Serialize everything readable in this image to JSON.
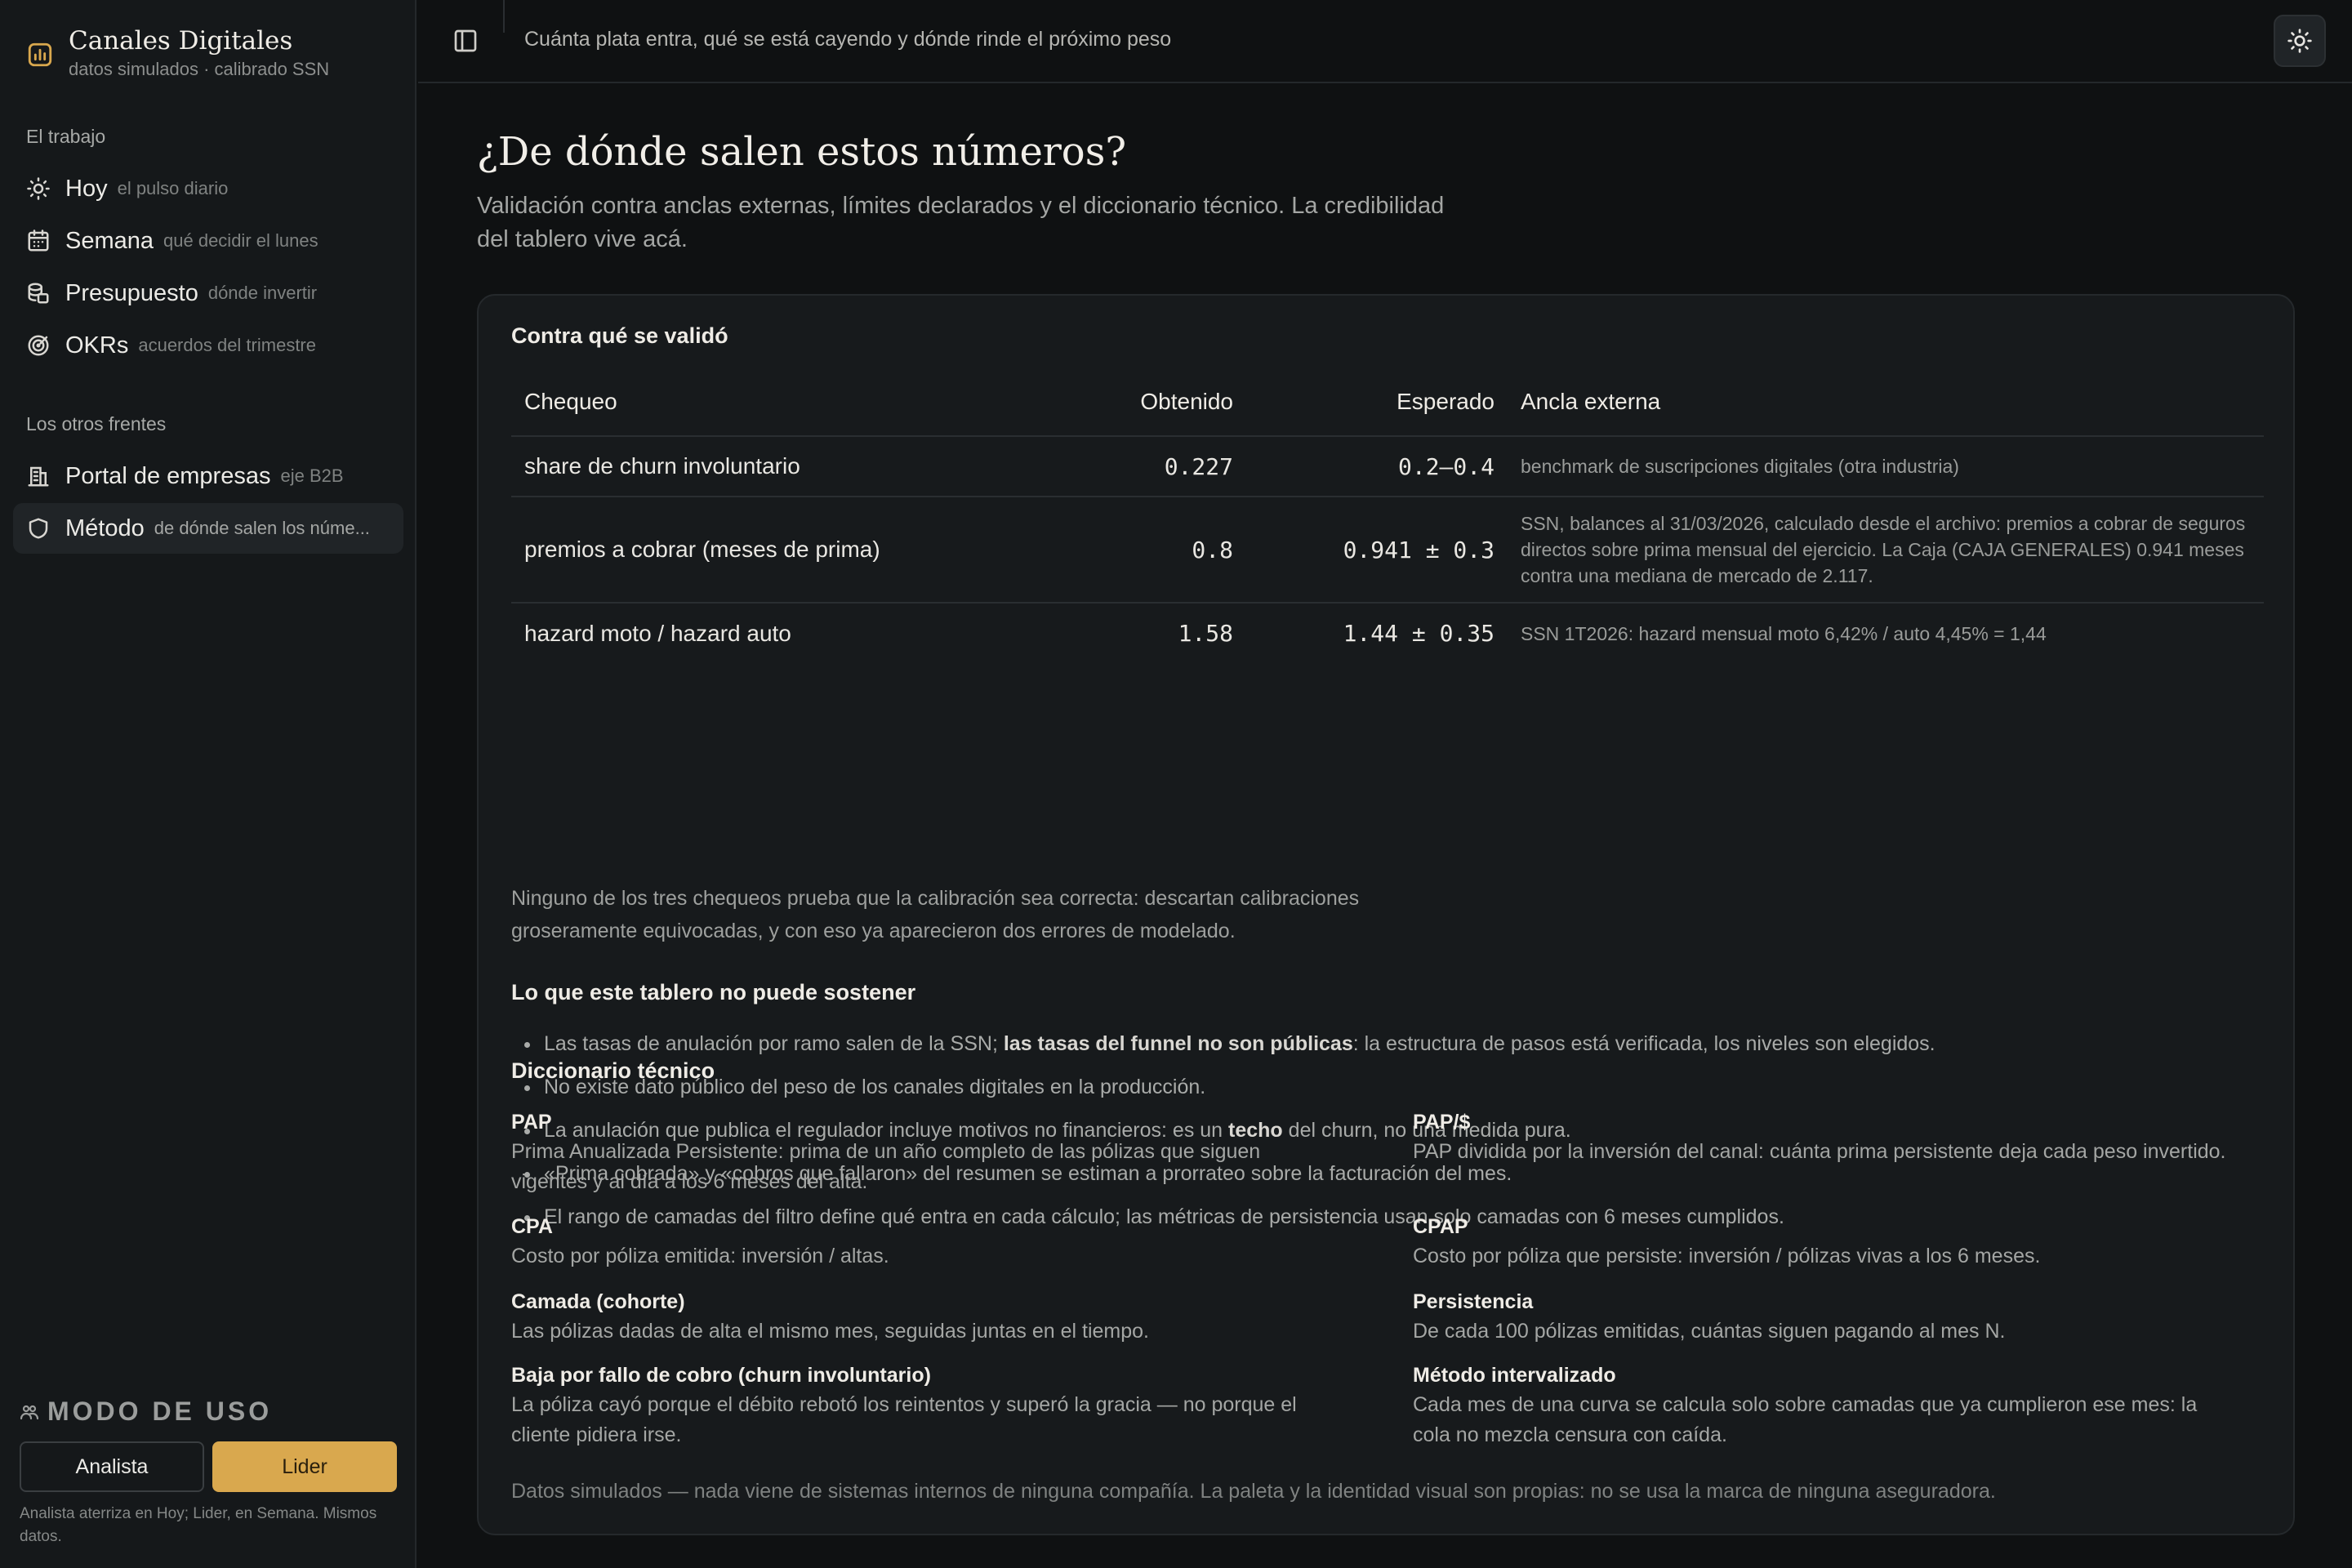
{
  "app": {
    "title": "Canales Digitales",
    "subtitle": "datos simulados · calibrado SSN"
  },
  "sidebar": {
    "section_work": "El trabajo",
    "section_other": "Los otros frentes",
    "items": [
      {
        "label": "Hoy",
        "hint": "el pulso diario",
        "icon": "sun-icon"
      },
      {
        "label": "Semana",
        "hint": "qué decidir el lunes",
        "icon": "calendar-icon"
      },
      {
        "label": "Presupuesto",
        "hint": "dónde invertir",
        "icon": "coins-icon"
      },
      {
        "label": "OKRs",
        "hint": "acuerdos del trimestre",
        "icon": "target-icon"
      },
      {
        "label": "Portal de empresas",
        "hint": "eje B2B",
        "icon": "building-icon"
      },
      {
        "label": "Método",
        "hint": "de dónde salen los núme...",
        "icon": "shield-icon",
        "active": true
      }
    ]
  },
  "mode": {
    "title": "MODO DE USO",
    "analista": "Analista",
    "lider": "Lider",
    "selected": "Lider",
    "note": "Analista aterriza en Hoy; Lider, en Semana. Mismos datos."
  },
  "topbar": {
    "text": "Cuánta plata entra, qué se está cayendo y dónde rinde el próximo peso"
  },
  "page": {
    "title": "¿De dónde salen estos números?",
    "subtitle": "Validación contra anclas externas, límites declarados y el diccionario técnico. La credibilidad del tablero vive acá."
  },
  "validation": {
    "heading": "Contra qué se validó",
    "columns": {
      "check": "Chequeo",
      "obtained": "Obtenido",
      "expected": "Esperado",
      "anchor": "Ancla externa"
    },
    "rows": [
      {
        "check": "share de churn involuntario",
        "obtained": "0.227",
        "expected": "0.2–0.4",
        "anchor": "benchmark de suscripciones digitales (otra industria)"
      },
      {
        "check": "premios a cobrar (meses de prima)",
        "obtained": "0.8",
        "expected": "0.941 ± 0.3",
        "anchor": "SSN, balances al 31/03/2026, calculado desde el archivo: premios a cobrar de seguros directos sobre prima mensual del ejercicio. La Caja (CAJA GENERALES) 0.941 meses contra una mediana de mercado de 2.117."
      },
      {
        "check": "hazard moto / hazard auto",
        "obtained": "1.58",
        "expected": "1.44 ± 0.35",
        "anchor": "SSN 1T2026: hazard mensual moto 6,42% / auto 4,45% = 1,44"
      }
    ],
    "note": "Ninguno de los tres chequeos prueba que la calibración sea correcta: descartan calibraciones groseramente equivocadas, y con eso ya aparecieron dos errores de modelado."
  },
  "limits": {
    "heading": "Lo que este tablero no puede sostener",
    "items": [
      {
        "pre": "Las tasas de anulación por ramo salen de la SSN; ",
        "bold": "las tasas del funnel no son públicas",
        "post": ": la estructura de pasos está verificada, los niveles son elegidos."
      },
      {
        "pre": "No existe dato público del peso de los canales digitales en la producción.",
        "bold": "",
        "post": ""
      },
      {
        "pre": "La anulación que publica el regulador incluye motivos no financieros: es un ",
        "bold": "techo",
        "post": " del churn, no una medida pura."
      },
      {
        "pre": "«Prima cobrada» y «cobros que fallaron» del resumen se estiman a prorrateo sobre la facturación del mes.",
        "bold": "",
        "post": ""
      },
      {
        "pre": "El rango de camadas del filtro define qué entra en cada cálculo; las métricas de persistencia usan solo camadas con 6 meses cumplidos.",
        "bold": "",
        "post": ""
      }
    ]
  },
  "dictionary": {
    "heading": "Diccionario técnico",
    "terms": [
      {
        "term": "PAP",
        "def": "Prima Anualizada Persistente: prima de un año completo de las pólizas que siguen vigentes y al día a los 6 meses del alta."
      },
      {
        "term": "PAP/$",
        "def": "PAP dividida por la inversión del canal: cuánta prima persistente deja cada peso invertido."
      },
      {
        "term": "CPA",
        "def": "Costo por póliza emitida: inversión / altas."
      },
      {
        "term": "CPAP",
        "def": "Costo por póliza que persiste: inversión / pólizas vivas a los 6 meses."
      },
      {
        "term": "Camada (cohorte)",
        "def": "Las pólizas dadas de alta el mismo mes, seguidas juntas en el tiempo."
      },
      {
        "term": "Persistencia",
        "def": "De cada 100 pólizas emitidas, cuántas siguen pagando al mes N."
      },
      {
        "term": "Baja por fallo de cobro (churn involuntario)",
        "def": "La póliza cayó porque el débito rebotó los reintentos y superó la gracia — no porque el cliente pidiera irse."
      },
      {
        "term": "Método intervalizado",
        "def": "Cada mes de una curva se calcula solo sobre camadas que ya cumplieron ese mes: la cola no mezcla censura con caída."
      }
    ]
  },
  "footer": {
    "note": "Datos simulados — nada viene de sistemas internos de ninguna compañía. La paleta y la identidad visual son propias: no se usa la marca de ninguna aseguradora."
  },
  "colors": {
    "accent": "#d9a84e",
    "background": "#0f1112",
    "sidebar": "#15181a",
    "card": "#171a1c"
  }
}
